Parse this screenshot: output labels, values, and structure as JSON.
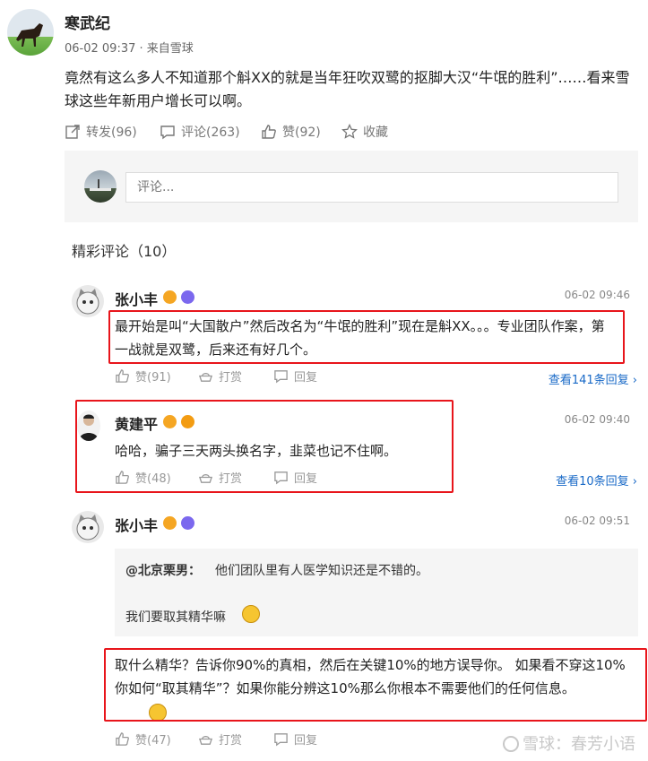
{
  "post": {
    "author": "寒武纪",
    "meta": "06-02 09:37 · 来自雪球",
    "body": "竟然有这么多人不知道那个斛XX的就是当年狂吹双鹭的抠脚大汉“牛氓的胜利”……看来雪球这些年新用户增长可以啊。",
    "actions": {
      "repost": "转发(96)",
      "comment": "评论(263)",
      "like": "赞(92)",
      "favorite": "收藏"
    }
  },
  "comment_box": {
    "placeholder": "评论..."
  },
  "section_title": "精彩评论（10）",
  "comments": [
    {
      "user": "张小丰",
      "time": "06-02 09:46",
      "text": "最开始是叫“大国散户”然后改名为“牛氓的胜利”现在是斛XX。。。专业团队作案，第一战就是双鹭，后来还有好几个。",
      "like": "赞(91)",
      "tip": "打赏",
      "reply": "回复",
      "view_replies": "查看141条回复"
    },
    {
      "user": "黄建平",
      "time": "06-02 09:40",
      "text": "哈哈，骗子三天两头换名字，韭菜也记不住啊。",
      "like": "赞(48)",
      "tip": "打赏",
      "reply": "回复",
      "view_replies": "查看10条回复"
    },
    {
      "user": "张小丰",
      "time": "06-02 09:51",
      "quote_user": "@北京栗男：",
      "quote_text": "他们团队里有人医学知识还是不错的。",
      "quote_text2": "我们要取其精华嘛",
      "text": "取什么精华？告诉你90%的真相，然后在关键10%的地方误导你。 如果看不穿这10%你如何“取其精华”？如果你能分辨这10%那么你根本不需要他们的任何信息。",
      "like": "赞(47)",
      "tip": "打赏",
      "reply": "回复"
    }
  ],
  "watermark": "雪球：春芳小语",
  "colors": {
    "highlight_box": "#e8151b",
    "link_blue": "#1869c7",
    "badge_gold": "#f5a623",
    "badge_purple": "#7b68ee",
    "badge_orange": "#f39c12"
  }
}
